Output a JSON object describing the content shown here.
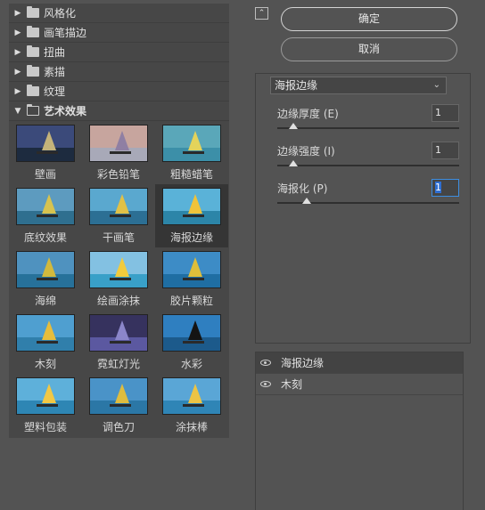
{
  "categories": [
    {
      "label": "风格化",
      "open": false
    },
    {
      "label": "画笔描边",
      "open": false
    },
    {
      "label": "扭曲",
      "open": false
    },
    {
      "label": "素描",
      "open": false
    },
    {
      "label": "纹理",
      "open": false
    },
    {
      "label": "艺术效果",
      "open": true
    }
  ],
  "thumbnails": [
    {
      "label": "壁画",
      "sky": "#3b4a7a",
      "sea": "#1d2b3f",
      "sail": "#c4b37a"
    },
    {
      "label": "彩色铅笔",
      "sky": "#c7a59e",
      "sea": "#a8a9b8",
      "sail": "#8f7fa3"
    },
    {
      "label": "粗糙蜡笔",
      "sky": "#5aa7b9",
      "sea": "#3c8fa8",
      "sail": "#e3d35b"
    },
    {
      "label": "底纹效果",
      "sky": "#5d9bbf",
      "sea": "#2f6f8f",
      "sail": "#d7c34f"
    },
    {
      "label": "干画笔",
      "sky": "#5aa8cf",
      "sea": "#2c6f94",
      "sail": "#e1c147"
    },
    {
      "label": "海报边缘",
      "sky": "#5ab2d8",
      "sea": "#2c85a8",
      "sail": "#f0c33a"
    },
    {
      "label": "海绵",
      "sky": "#4f92bf",
      "sea": "#27719a",
      "sail": "#d2b93d"
    },
    {
      "label": "绘画涂抹",
      "sky": "#83c1e2",
      "sea": "#39a0c8",
      "sail": "#f2cb3c"
    },
    {
      "label": "胶片颗粒",
      "sky": "#3d8cc6",
      "sea": "#1f6ea3",
      "sail": "#dfbe3a"
    },
    {
      "label": "木刻",
      "sky": "#4f9fd0",
      "sea": "#307fab",
      "sail": "#e7bd3b"
    },
    {
      "label": "霓虹灯光",
      "sky": "#36325e",
      "sea": "#5b58a0",
      "sail": "#8b86c9"
    },
    {
      "label": "水彩",
      "sky": "#2f7fc0",
      "sea": "#1c5a8b",
      "sail": "#141414"
    },
    {
      "label": "塑料包装",
      "sky": "#5eb0da",
      "sea": "#2e86b4",
      "sail": "#f2c845"
    },
    {
      "label": "调色刀",
      "sky": "#4a93c8",
      "sea": "#2b77a6",
      "sail": "#dfbd3f"
    },
    {
      "label": "涂抹棒",
      "sky": "#5aa6d6",
      "sea": "#2f85b6",
      "sail": "#ecc445"
    }
  ],
  "buttons": {
    "ok": "确定",
    "cancel": "取消",
    "collapse_icon": "chevron-up-icon"
  },
  "settings": {
    "filter_name": "海报边缘",
    "params": [
      {
        "label": "边缘厚度 (E)",
        "value": "1",
        "slider_fraction": 0.09
      },
      {
        "label": "边缘强度 (I)",
        "value": "1",
        "slider_fraction": 0.09
      },
      {
        "label": "海报化 (P)",
        "value": "1",
        "slider_fraction": 0.16
      }
    ]
  },
  "layers": [
    {
      "name": "海报边缘",
      "visible": true
    },
    {
      "name": "木刻",
      "visible": true
    }
  ]
}
